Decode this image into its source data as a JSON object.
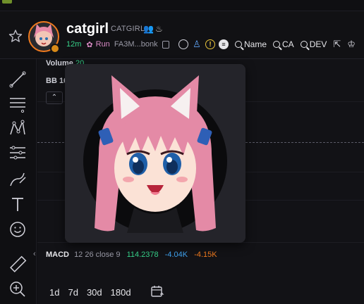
{
  "token": {
    "name": "catgirl",
    "ticker": "CATGIRL",
    "age": "12m",
    "platform": "Run",
    "address": "FA3M...bonk"
  },
  "header_links": {
    "search_name": "Name",
    "search_ca": "CA",
    "search_dev": "DEV"
  },
  "chart": {
    "volume_label": "Volume",
    "volume_value": "20",
    "bb_label": "BB 16",
    "macd": {
      "label": "MACD",
      "params": "12 26 close 9",
      "value_1": "114.2378",
      "value_2": "-4.04K",
      "value_3": "-4.15K"
    }
  },
  "timeframes": [
    "1d",
    "7d",
    "30d",
    "180d"
  ],
  "colors": {
    "accent_orange": "#f07a1e",
    "positive_green": "#37d28a",
    "blue": "#3fa3ef",
    "run_pink": "#d98ac4"
  },
  "icons": {
    "star": "star-icon",
    "globe": "globe-icon",
    "person": "person-icon",
    "warning": "warning-icon",
    "book": "book-icon",
    "external": "external-link-icon",
    "chef": "chef-hat-icon",
    "calendar": "calendar-icon"
  }
}
